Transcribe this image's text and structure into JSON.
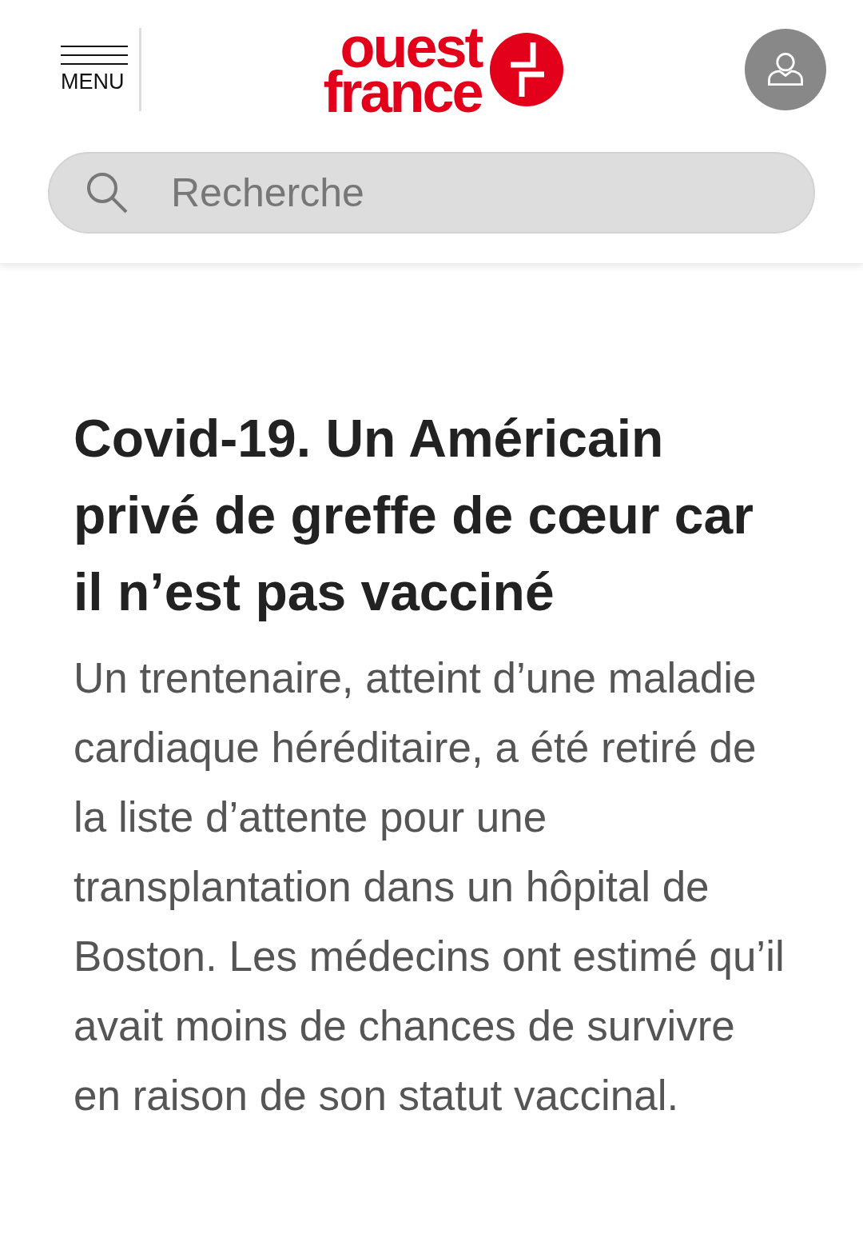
{
  "header": {
    "menu_label": "MENU",
    "logo": {
      "line_1": "ouest",
      "line_2": "france"
    },
    "search": {
      "placeholder": "Recherche"
    }
  },
  "article": {
    "title": "Covid-19. Un Américain privé de greffe de cœur car il n’est pas vacciné",
    "summary": "Un trentenaire, atteint d’une maladie cardiaque héréditaire, a été retiré de la liste d’attente pour une transplantation dans un hôpital de Boston. Les médecins ont estimé qu’il avait moins de chances de survivre en raison de son statut vaccinal."
  }
}
